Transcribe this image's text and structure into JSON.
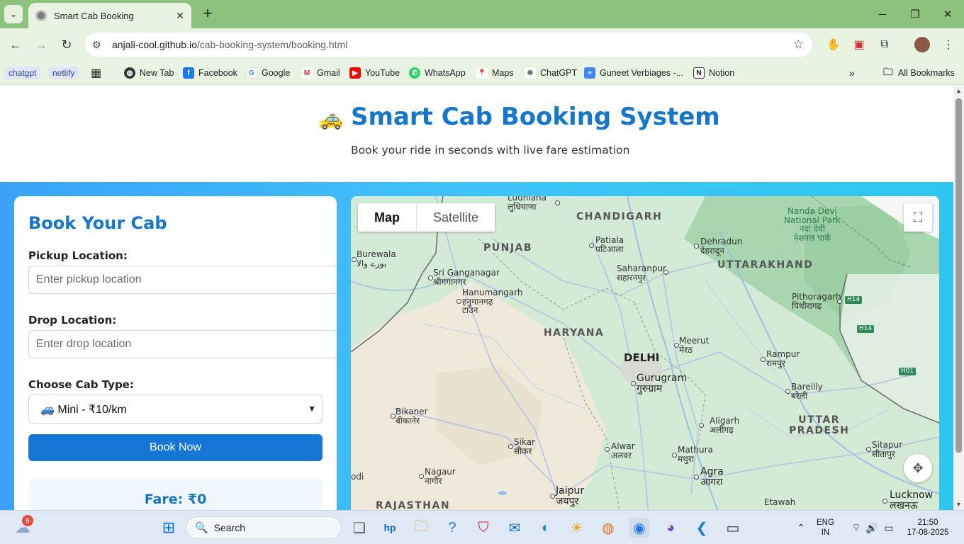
{
  "browser": {
    "tab_title": "Smart Cab Booking",
    "url_host": "anjali-cool.github.io",
    "url_path": "/cab-booking-system/booking.html",
    "bookmarks": [
      {
        "label": "chatgpt",
        "icon": "chip"
      },
      {
        "label": "netlify",
        "icon": "chip"
      },
      {
        "label": "New Tab",
        "icon": "globe-icon"
      },
      {
        "label": "Facebook",
        "icon": "facebook-icon"
      },
      {
        "label": "Google",
        "icon": "google-icon"
      },
      {
        "label": "Gmail",
        "icon": "gmail-icon"
      },
      {
        "label": "YouTube",
        "icon": "youtube-icon"
      },
      {
        "label": "WhatsApp",
        "icon": "whatsapp-icon"
      },
      {
        "label": "Maps",
        "icon": "maps-icon"
      },
      {
        "label": "ChatGPT",
        "icon": "chatgpt-icon"
      },
      {
        "label": "Guneet Verbiages -...",
        "icon": "docs-icon"
      },
      {
        "label": "Notion",
        "icon": "notion-icon"
      }
    ],
    "all_bookmarks": "All Bookmarks"
  },
  "header": {
    "logo": "🚕",
    "title": "Smart Cab Booking System",
    "subtitle": "Book your ride in seconds with live fare estimation"
  },
  "form": {
    "heading": "Book Your Cab",
    "pickup_label": "Pickup Location:",
    "pickup_placeholder": "Enter pickup location",
    "drop_label": "Drop Location:",
    "drop_placeholder": "Enter drop location",
    "cab_label": "Choose Cab Type:",
    "cab_selected": "🚙 Mini - ₹10/km",
    "book_button": "Book Now",
    "fare": "Fare: ₹0"
  },
  "map": {
    "tab_map": "Map",
    "tab_satellite": "Satellite",
    "labels": {
      "ludhiana": "Ludhiana\nलुधियाणा",
      "chandigarh": "CHANDIGARH",
      "nanda_devi": "Nanda Devi\nNational Park\nनंदा देवी\nनेशनल पार्क",
      "burewala": "Burewala\nبورے والا",
      "punjab": "PUNJAB",
      "patiala": "Patiala\nपटिआला",
      "dehradun": "Dehradun\nदेहरादून",
      "uttarakhand": "UTTARAKHAND",
      "sri_ganganagar": "Sri Ganganagar\nश्रीगंगानगर",
      "saharanpur": "Saharanpur\nसहारनपुर",
      "hanumangarh": "Hanumangarh\nहनुमानगढ़\nटाउन",
      "pithoragarh": "Pithoragarh\nपिथौरागढ़",
      "haryana": "HARYANA",
      "meerut": "Meerut\nमेरठ",
      "delhi": "DELHI",
      "rampur": "Rampur\nरामपुर",
      "gurugram": "Gurugram\nगुरुग्राम",
      "bareilly": "Bareilly\nबरेली",
      "bikaner": "Bikaner\nबीकानेर",
      "aligarh": "Aligarh\nअलीगढ़",
      "uttar_pradesh": "UTTAR\nPRADESH",
      "sikar": "Sikar\nसीकर",
      "alwar": "Alwar\nअलवर",
      "mathura": "Mathura\nमथुरा",
      "sitapur": "Sitapur\nसीतापुर",
      "nagaur": "Nagaur\nनागौर",
      "agra": "Agra\nआगरा",
      "jaipur": "Jaipur\nजयपुर",
      "lucknow": "Lucknow\nलखनऊ",
      "rajasthan": "RAJASTHAN",
      "etawah": "Etawah",
      "odi": "odi",
      "h14a": "H14",
      "h14b": "H14",
      "h01": "H01"
    }
  },
  "taskbar": {
    "search": "Search",
    "lang_top": "ENG",
    "lang_bottom": "IN",
    "time": "21:50",
    "date": "17-08-2025",
    "weather_badge": "6"
  }
}
